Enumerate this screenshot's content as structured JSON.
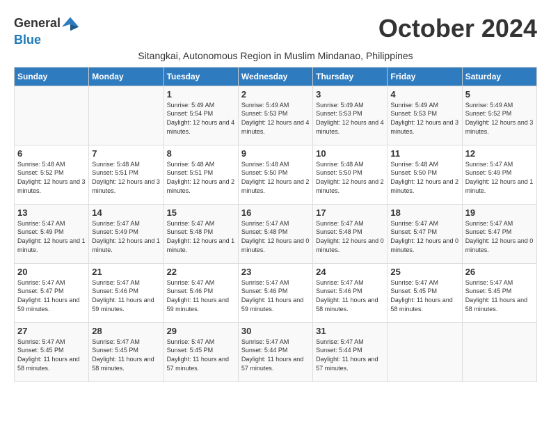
{
  "logo": {
    "general": "General",
    "blue": "Blue"
  },
  "title": "October 2024",
  "subtitle": "Sitangkai, Autonomous Region in Muslim Mindanao, Philippines",
  "weekdays": [
    "Sunday",
    "Monday",
    "Tuesday",
    "Wednesday",
    "Thursday",
    "Friday",
    "Saturday"
  ],
  "weeks": [
    [
      {
        "day": "",
        "info": ""
      },
      {
        "day": "",
        "info": ""
      },
      {
        "day": "1",
        "info": "Sunrise: 5:49 AM\nSunset: 5:54 PM\nDaylight: 12 hours\nand 4 minutes."
      },
      {
        "day": "2",
        "info": "Sunrise: 5:49 AM\nSunset: 5:53 PM\nDaylight: 12 hours\nand 4 minutes."
      },
      {
        "day": "3",
        "info": "Sunrise: 5:49 AM\nSunset: 5:53 PM\nDaylight: 12 hours\nand 4 minutes."
      },
      {
        "day": "4",
        "info": "Sunrise: 5:49 AM\nSunset: 5:53 PM\nDaylight: 12 hours\nand 3 minutes."
      },
      {
        "day": "5",
        "info": "Sunrise: 5:49 AM\nSunset: 5:52 PM\nDaylight: 12 hours\nand 3 minutes."
      }
    ],
    [
      {
        "day": "6",
        "info": "Sunrise: 5:48 AM\nSunset: 5:52 PM\nDaylight: 12 hours\nand 3 minutes."
      },
      {
        "day": "7",
        "info": "Sunrise: 5:48 AM\nSunset: 5:51 PM\nDaylight: 12 hours\nand 3 minutes."
      },
      {
        "day": "8",
        "info": "Sunrise: 5:48 AM\nSunset: 5:51 PM\nDaylight: 12 hours\nand 2 minutes."
      },
      {
        "day": "9",
        "info": "Sunrise: 5:48 AM\nSunset: 5:50 PM\nDaylight: 12 hours\nand 2 minutes."
      },
      {
        "day": "10",
        "info": "Sunrise: 5:48 AM\nSunset: 5:50 PM\nDaylight: 12 hours\nand 2 minutes."
      },
      {
        "day": "11",
        "info": "Sunrise: 5:48 AM\nSunset: 5:50 PM\nDaylight: 12 hours\nand 2 minutes."
      },
      {
        "day": "12",
        "info": "Sunrise: 5:47 AM\nSunset: 5:49 PM\nDaylight: 12 hours\nand 1 minute."
      }
    ],
    [
      {
        "day": "13",
        "info": "Sunrise: 5:47 AM\nSunset: 5:49 PM\nDaylight: 12 hours\nand 1 minute."
      },
      {
        "day": "14",
        "info": "Sunrise: 5:47 AM\nSunset: 5:49 PM\nDaylight: 12 hours\nand 1 minute."
      },
      {
        "day": "15",
        "info": "Sunrise: 5:47 AM\nSunset: 5:48 PM\nDaylight: 12 hours\nand 1 minute."
      },
      {
        "day": "16",
        "info": "Sunrise: 5:47 AM\nSunset: 5:48 PM\nDaylight: 12 hours\nand 0 minutes."
      },
      {
        "day": "17",
        "info": "Sunrise: 5:47 AM\nSunset: 5:48 PM\nDaylight: 12 hours\nand 0 minutes."
      },
      {
        "day": "18",
        "info": "Sunrise: 5:47 AM\nSunset: 5:47 PM\nDaylight: 12 hours\nand 0 minutes."
      },
      {
        "day": "19",
        "info": "Sunrise: 5:47 AM\nSunset: 5:47 PM\nDaylight: 12 hours\nand 0 minutes."
      }
    ],
    [
      {
        "day": "20",
        "info": "Sunrise: 5:47 AM\nSunset: 5:47 PM\nDaylight: 11 hours\nand 59 minutes."
      },
      {
        "day": "21",
        "info": "Sunrise: 5:47 AM\nSunset: 5:46 PM\nDaylight: 11 hours\nand 59 minutes."
      },
      {
        "day": "22",
        "info": "Sunrise: 5:47 AM\nSunset: 5:46 PM\nDaylight: 11 hours\nand 59 minutes."
      },
      {
        "day": "23",
        "info": "Sunrise: 5:47 AM\nSunset: 5:46 PM\nDaylight: 11 hours\nand 59 minutes."
      },
      {
        "day": "24",
        "info": "Sunrise: 5:47 AM\nSunset: 5:46 PM\nDaylight: 11 hours\nand 58 minutes."
      },
      {
        "day": "25",
        "info": "Sunrise: 5:47 AM\nSunset: 5:45 PM\nDaylight: 11 hours\nand 58 minutes."
      },
      {
        "day": "26",
        "info": "Sunrise: 5:47 AM\nSunset: 5:45 PM\nDaylight: 11 hours\nand 58 minutes."
      }
    ],
    [
      {
        "day": "27",
        "info": "Sunrise: 5:47 AM\nSunset: 5:45 PM\nDaylight: 11 hours\nand 58 minutes."
      },
      {
        "day": "28",
        "info": "Sunrise: 5:47 AM\nSunset: 5:45 PM\nDaylight: 11 hours\nand 58 minutes."
      },
      {
        "day": "29",
        "info": "Sunrise: 5:47 AM\nSunset: 5:45 PM\nDaylight: 11 hours\nand 57 minutes."
      },
      {
        "day": "30",
        "info": "Sunrise: 5:47 AM\nSunset: 5:44 PM\nDaylight: 11 hours\nand 57 minutes."
      },
      {
        "day": "31",
        "info": "Sunrise: 5:47 AM\nSunset: 5:44 PM\nDaylight: 11 hours\nand 57 minutes."
      },
      {
        "day": "",
        "info": ""
      },
      {
        "day": "",
        "info": ""
      }
    ]
  ]
}
